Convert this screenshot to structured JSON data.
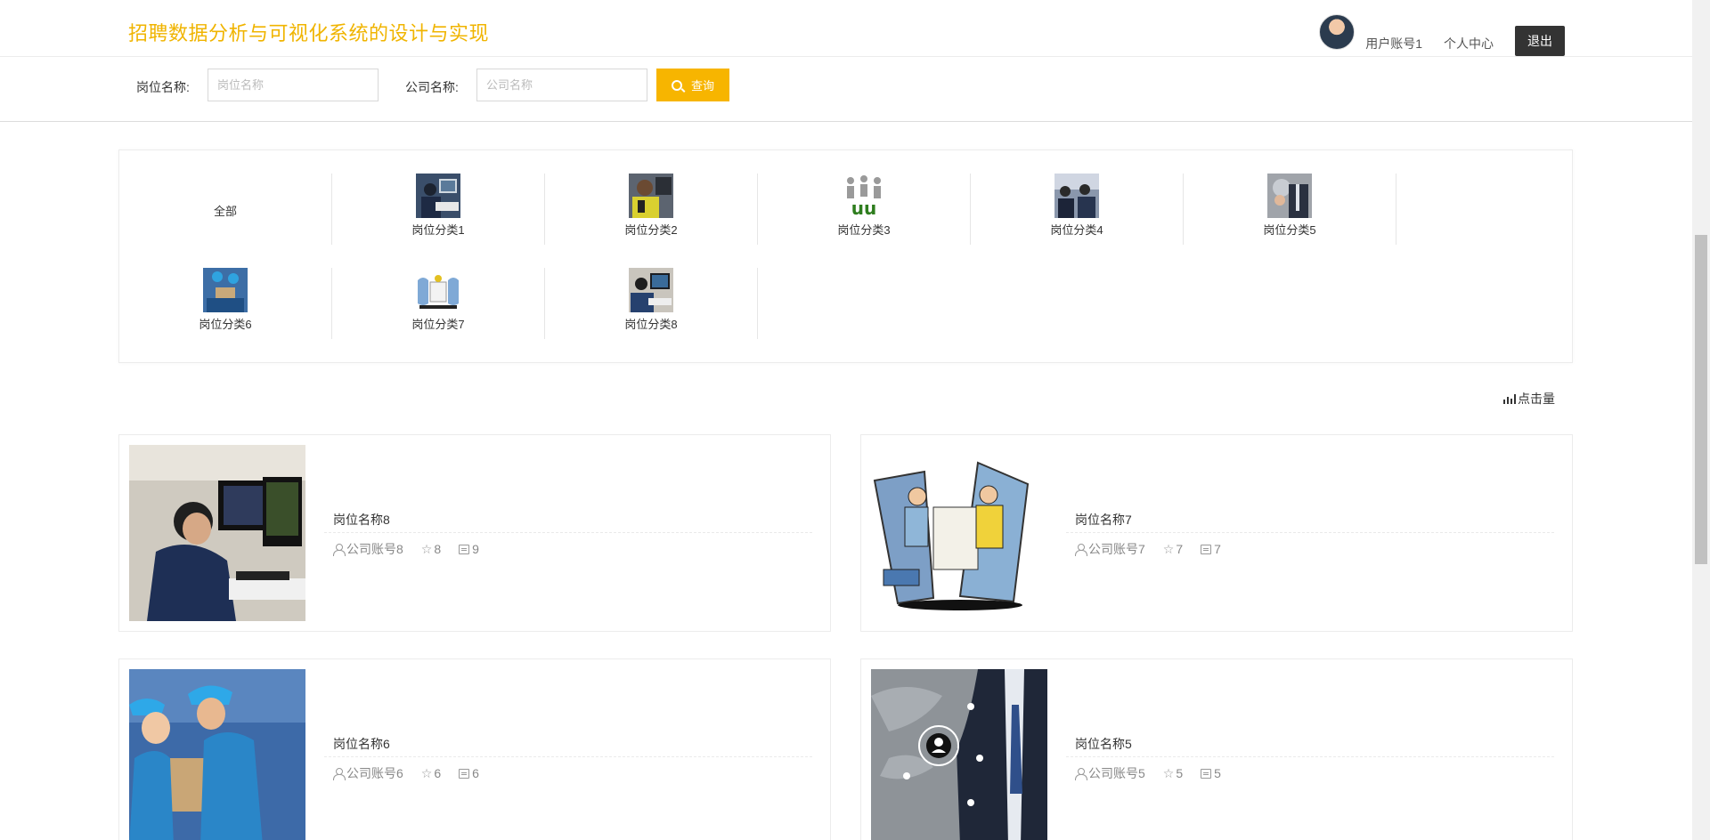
{
  "header": {
    "brand": "招聘数据分析与可视化系统的设计与实现",
    "username": "用户账号1",
    "profile_link": "个人中心",
    "logout_label": "退出"
  },
  "search": {
    "job_label": "岗位名称:",
    "job_placeholder": "岗位名称",
    "company_label": "公司名称:",
    "company_placeholder": "公司名称",
    "button_label": "查询"
  },
  "categories": [
    {
      "label": "全部"
    },
    {
      "label": "岗位分类1",
      "thumb": "office-worker"
    },
    {
      "label": "岗位分类2",
      "thumb": "yellow-worker"
    },
    {
      "label": "岗位分类3",
      "thumb": "3d-figures"
    },
    {
      "label": "岗位分类4",
      "thumb": "meeting"
    },
    {
      "label": "岗位分类5",
      "thumb": "businessman"
    },
    {
      "label": "岗位分类6",
      "thumb": "delivery"
    },
    {
      "label": "岗位分类7",
      "thumb": "cartoon"
    },
    {
      "label": "岗位分类8",
      "thumb": "computer-worker"
    }
  ],
  "sort": {
    "label": "点击量"
  },
  "jobs": [
    {
      "title": "岗位名称8",
      "company": "公司账号8",
      "stars": "8",
      "comments": "9"
    },
    {
      "title": "岗位名称7",
      "company": "公司账号7",
      "stars": "7",
      "comments": "7"
    },
    {
      "title": "岗位名称6",
      "company": "公司账号6",
      "stars": "6",
      "comments": "6"
    },
    {
      "title": "岗位名称5",
      "company": "公司账号5",
      "stars": "5",
      "comments": "5"
    }
  ],
  "colors": {
    "brand": "#f0b400",
    "search_button": "#f7b500",
    "logout_button": "#333333"
  }
}
